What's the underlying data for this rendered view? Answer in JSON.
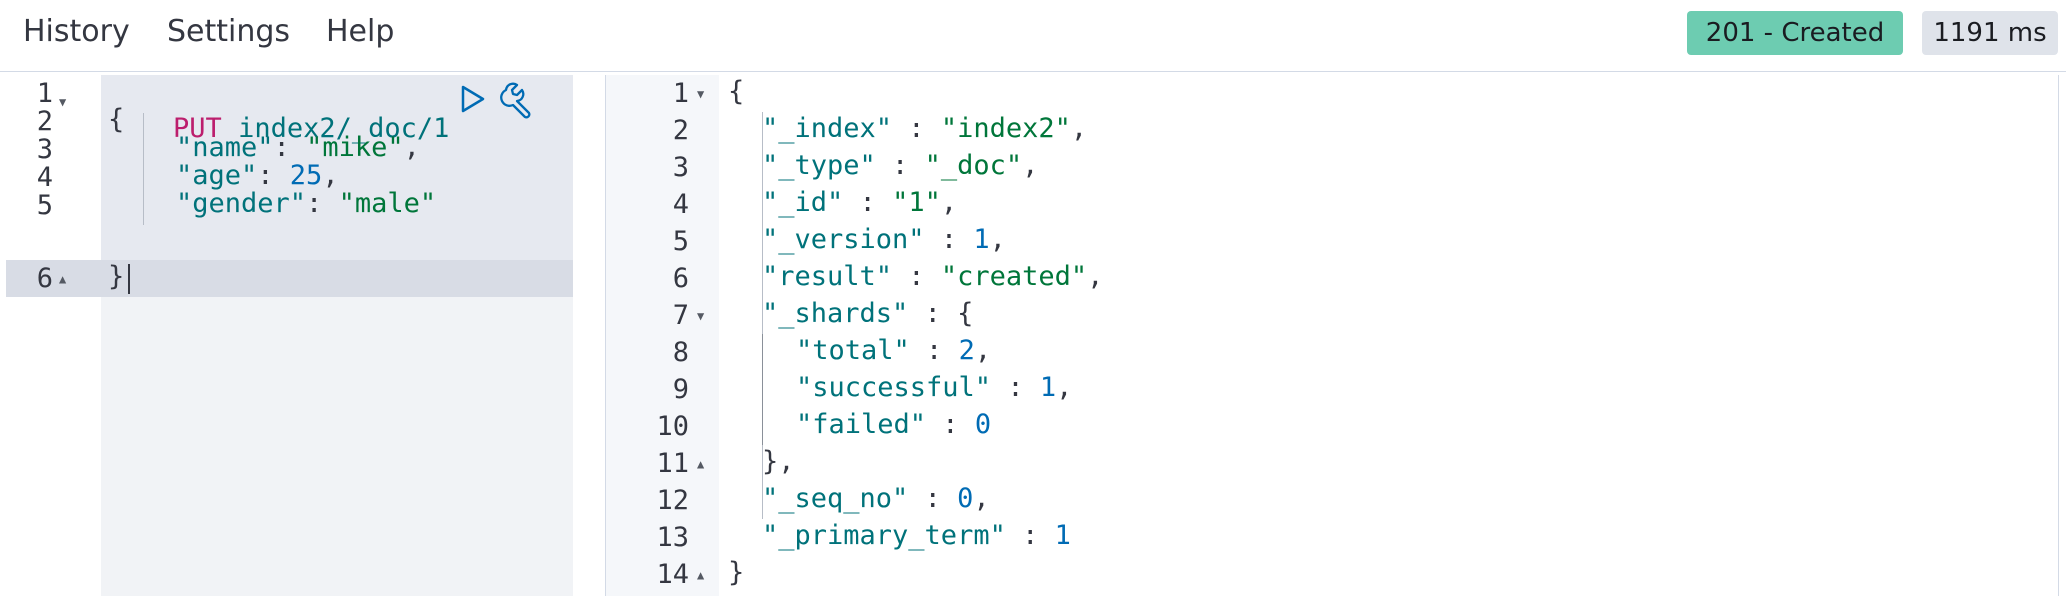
{
  "menu": {
    "history": "History",
    "settings": "Settings",
    "help": "Help"
  },
  "status": {
    "code_label": "201 - Created",
    "time_label": "1191 ms",
    "success_color": "#6dccb1"
  },
  "request": {
    "line_numbers": [
      "1",
      "2",
      "3",
      "4",
      "5",
      "6"
    ],
    "method": "PUT",
    "path": "index2/_doc/1",
    "open_brace": "{",
    "close_brace": "}",
    "fields": [
      {
        "key": "\"name\"",
        "sep": ": ",
        "value": "\"mike\"",
        "value_type": "string",
        "trail": ","
      },
      {
        "key": "\"age\"",
        "sep": ": ",
        "value": "25",
        "value_type": "number",
        "trail": ","
      },
      {
        "key": "\"gender\"",
        "sep": ": ",
        "value": "\"male\"",
        "value_type": "string",
        "trail": ""
      }
    ],
    "icons": [
      "play-icon",
      "wrench-icon"
    ]
  },
  "response": {
    "line_numbers": [
      "1",
      "2",
      "3",
      "4",
      "5",
      "6",
      "7",
      "8",
      "9",
      "10",
      "11",
      "12",
      "13",
      "14"
    ],
    "lines": [
      {
        "key": "",
        "sep": "",
        "value": "{",
        "value_type": "punc",
        "trail": ""
      },
      {
        "key": "\"_index\"",
        "sep": " : ",
        "value": "\"index2\"",
        "value_type": "string",
        "trail": ","
      },
      {
        "key": "\"_type\"",
        "sep": " : ",
        "value": "\"_doc\"",
        "value_type": "string",
        "trail": ","
      },
      {
        "key": "\"_id\"",
        "sep": " : ",
        "value": "\"1\"",
        "value_type": "string",
        "trail": ","
      },
      {
        "key": "\"_version\"",
        "sep": " : ",
        "value": "1",
        "value_type": "number",
        "trail": ","
      },
      {
        "key": "\"result\"",
        "sep": " : ",
        "value": "\"created\"",
        "value_type": "string",
        "trail": ","
      },
      {
        "key": "\"_shards\"",
        "sep": " : ",
        "value": "{",
        "value_type": "punc",
        "trail": ""
      },
      {
        "key": "\"total\"",
        "sep": " : ",
        "value": "2",
        "value_type": "number",
        "trail": ","
      },
      {
        "key": "\"successful\"",
        "sep": " : ",
        "value": "1",
        "value_type": "number",
        "trail": ","
      },
      {
        "key": "\"failed\"",
        "sep": " : ",
        "value": "0",
        "value_type": "number",
        "trail": ""
      },
      {
        "key": "",
        "sep": "",
        "value": "}",
        "value_type": "punc",
        "trail": ","
      },
      {
        "key": "\"_seq_no\"",
        "sep": " : ",
        "value": "0",
        "value_type": "number",
        "trail": ","
      },
      {
        "key": "\"_primary_term\"",
        "sep": " : ",
        "value": "1",
        "value_type": "number",
        "trail": ""
      },
      {
        "key": "",
        "sep": "",
        "value": "}",
        "value_type": "punc",
        "trail": ""
      }
    ]
  }
}
